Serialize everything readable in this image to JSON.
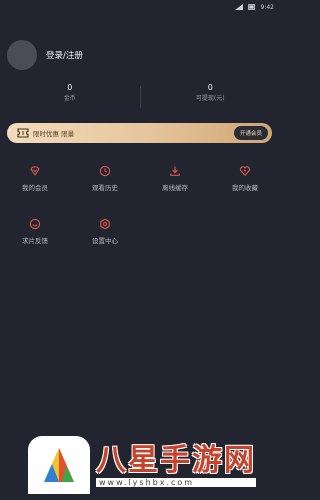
{
  "status_bar": {
    "time": "9:42",
    "battery_icon": "battery-icon",
    "signal_icon": "signal-icon"
  },
  "profile": {
    "login_label": "登录/注册"
  },
  "stats": [
    {
      "value": "0",
      "label": "金币"
    },
    {
      "value": "0",
      "label": "可提现(元)"
    }
  ],
  "promo": {
    "text": "限时优惠 限量",
    "button_label": "开通会员",
    "accent_color": "#e5c49b"
  },
  "menu": [
    {
      "label": "我的会员",
      "icon": "vip-icon"
    },
    {
      "label": "观看历史",
      "icon": "clock-icon"
    },
    {
      "label": "离线缓存",
      "icon": "download-icon"
    },
    {
      "label": "我的收藏",
      "icon": "favorite-icon"
    },
    {
      "label": "求片反馈",
      "icon": "feedback-icon"
    },
    {
      "label": "设置中心",
      "icon": "settings-icon"
    }
  ],
  "icon_color": "#e0594a",
  "watermark": {
    "title": "八星手游网",
    "url": "www.lyshbx.com"
  }
}
